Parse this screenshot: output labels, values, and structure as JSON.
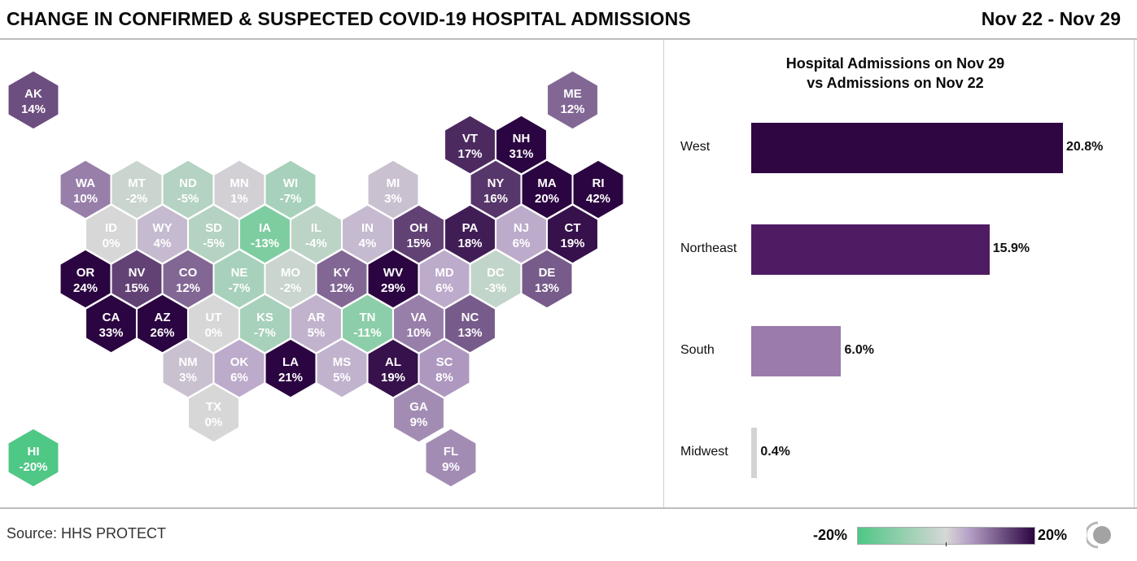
{
  "header": {
    "title": "CHANGE IN CONFIRMED & SUSPECTED COVID-19 HOSPITAL ADMISSIONS",
    "date_range": "Nov 22 - Nov 29"
  },
  "colors": {
    "scale_min": "#4fc785",
    "scale_mid": "#d6d7d6",
    "scale_max": "#2b0541",
    "west": "#2f0642",
    "northeast": "#4f1b63",
    "south": "#9a7bab",
    "midwest": "#d3d3d3"
  },
  "chart_data": [
    {
      "type": "heatmap",
      "title": "CHANGE IN CONFIRMED & SUSPECTED COVID-19 HOSPITAL ADMISSIONS",
      "subtitle": "Nov 22 - Nov 29",
      "value_unit": "%",
      "color_range": [
        -20,
        20
      ],
      "states": [
        {
          "code": "AK",
          "value": 14
        },
        {
          "code": "ME",
          "value": 12
        },
        {
          "code": "VT",
          "value": 17
        },
        {
          "code": "NH",
          "value": 31
        },
        {
          "code": "WA",
          "value": 10
        },
        {
          "code": "MT",
          "value": -2
        },
        {
          "code": "ND",
          "value": -5
        },
        {
          "code": "MN",
          "value": 1
        },
        {
          "code": "WI",
          "value": -7
        },
        {
          "code": "MI",
          "value": 3
        },
        {
          "code": "NY",
          "value": 16
        },
        {
          "code": "MA",
          "value": 20
        },
        {
          "code": "RI",
          "value": 42
        },
        {
          "code": "ID",
          "value": 0
        },
        {
          "code": "WY",
          "value": 4
        },
        {
          "code": "SD",
          "value": -5
        },
        {
          "code": "IA",
          "value": -13
        },
        {
          "code": "IL",
          "value": -4
        },
        {
          "code": "IN",
          "value": 4
        },
        {
          "code": "OH",
          "value": 15
        },
        {
          "code": "PA",
          "value": 18
        },
        {
          "code": "NJ",
          "value": 6
        },
        {
          "code": "CT",
          "value": 19
        },
        {
          "code": "OR",
          "value": 24
        },
        {
          "code": "NV",
          "value": 15
        },
        {
          "code": "CO",
          "value": 12
        },
        {
          "code": "NE",
          "value": -7
        },
        {
          "code": "MO",
          "value": -2
        },
        {
          "code": "KY",
          "value": 12
        },
        {
          "code": "WV",
          "value": 29
        },
        {
          "code": "MD",
          "value": 6
        },
        {
          "code": "DC",
          "value": -3
        },
        {
          "code": "DE",
          "value": 13
        },
        {
          "code": "CA",
          "value": 33
        },
        {
          "code": "AZ",
          "value": 26
        },
        {
          "code": "UT",
          "value": 0
        },
        {
          "code": "KS",
          "value": -7
        },
        {
          "code": "AR",
          "value": 5
        },
        {
          "code": "TN",
          "value": -11
        },
        {
          "code": "VA",
          "value": 10
        },
        {
          "code": "NC",
          "value": 13
        },
        {
          "code": "NM",
          "value": 3
        },
        {
          "code": "OK",
          "value": 6
        },
        {
          "code": "LA",
          "value": 21
        },
        {
          "code": "MS",
          "value": 5
        },
        {
          "code": "AL",
          "value": 19
        },
        {
          "code": "SC",
          "value": 8
        },
        {
          "code": "TX",
          "value": 0
        },
        {
          "code": "GA",
          "value": 9
        },
        {
          "code": "HI",
          "value": -20
        },
        {
          "code": "FL",
          "value": 9
        }
      ]
    },
    {
      "type": "bar",
      "title": "Hospital Admissions on Nov 29 vs Admissions on Nov 22",
      "categories": [
        "West",
        "Northeast",
        "South",
        "Midwest"
      ],
      "values": [
        20.8,
        15.9,
        6.0,
        0.4
      ],
      "value_labels": [
        "20.8%",
        "15.9%",
        "6.0%",
        "0.4%"
      ],
      "xlim": [
        0,
        20.8
      ],
      "orientation": "horizontal"
    }
  ],
  "bar_chart": {
    "title_line1": "Hospital Admissions on Nov 29",
    "title_line2": "vs Admissions on Nov 22"
  },
  "footer": {
    "source": "Source: HHS PROTECT",
    "legend_min": "-20%",
    "legend_max": "20%"
  }
}
